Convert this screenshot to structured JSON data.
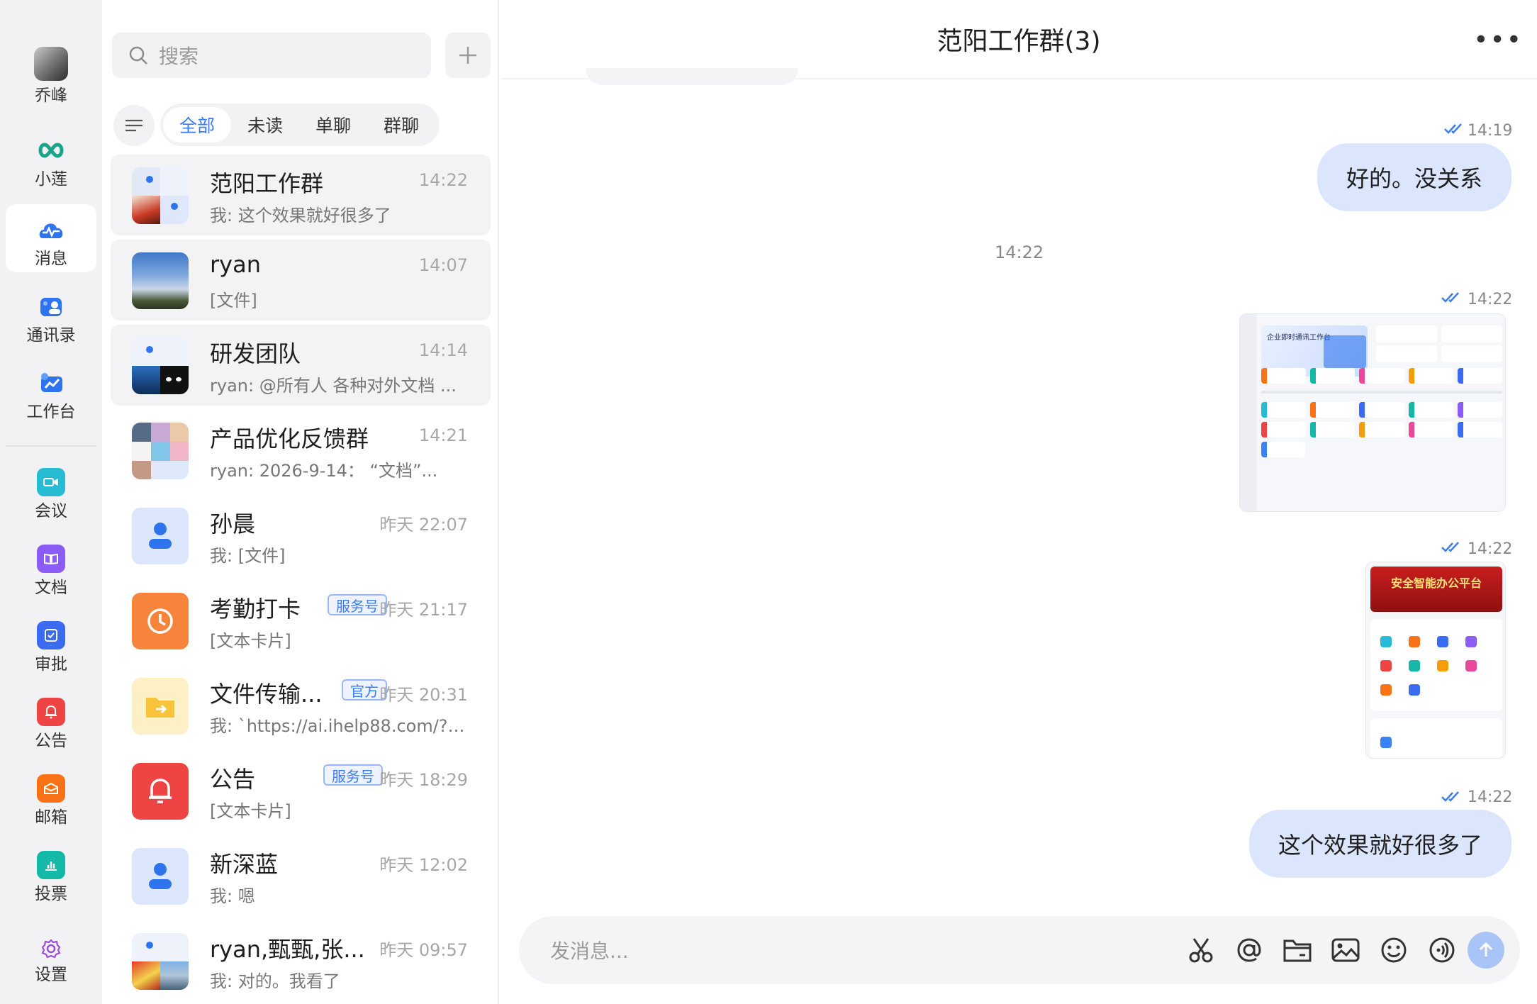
{
  "nav": {
    "profile_label": "乔峰",
    "items": [
      {
        "label": "小莲",
        "icon": "infinity-icon"
      },
      {
        "label": "消息",
        "icon": "chat-cloud-icon"
      },
      {
        "label": "通讯录",
        "icon": "contacts-icon"
      },
      {
        "label": "工作台",
        "icon": "workbench-icon"
      },
      {
        "label": "会议",
        "icon": "video-icon"
      },
      {
        "label": "文档",
        "icon": "book-icon"
      },
      {
        "label": "审批",
        "icon": "approve-icon"
      },
      {
        "label": "公告",
        "icon": "bell-icon"
      },
      {
        "label": "邮箱",
        "icon": "mail-icon"
      },
      {
        "label": "投票",
        "icon": "vote-icon"
      },
      {
        "label": "设置",
        "icon": "gear-icon"
      }
    ]
  },
  "list": {
    "search_placeholder": "搜索",
    "tabs": [
      "全部",
      "未读",
      "单聊",
      "群聊"
    ],
    "conversations": [
      {
        "name": "范阳工作群",
        "time": "14:22",
        "preview": "我: 这个效果就好很多了"
      },
      {
        "name": "ryan",
        "time": "14:07",
        "preview": "[文件]"
      },
      {
        "name": "研发团队",
        "time": "14:14",
        "preview": "ryan: @所有人 各种对外文档 ..."
      },
      {
        "name": "产品优化反馈群",
        "time": "14:21",
        "preview": "ryan: 2026-9-14： “文档”..."
      },
      {
        "name": "孙晨",
        "time": "昨天 22:07",
        "preview": "我: [文件]"
      },
      {
        "name": "考勤打卡",
        "badge": "服务号",
        "time": "昨天 21:17",
        "preview": "[文本卡片]"
      },
      {
        "name": "文件传输...",
        "badge": "官方",
        "time": "昨天 20:31",
        "preview": "我: `https://ai.ihelp88.com/?li..."
      },
      {
        "name": "公告",
        "badge": "服务号",
        "time": "昨天 18:29",
        "preview": "[文本卡片]"
      },
      {
        "name": "新深蓝",
        "time": "昨天 12:02",
        "preview": "我: 嗯"
      },
      {
        "name": "ryan,甄甄,张...",
        "time": "昨天 09:57",
        "preview": "我: 对的。我看了"
      }
    ]
  },
  "chat": {
    "title": "范阳工作群(3)",
    "messages": [
      {
        "time": "14:19",
        "text": "好的。没关系"
      },
      {
        "center_time": "14:22"
      },
      {
        "time": "14:22",
        "image": "企业即时通讯工作台"
      },
      {
        "time": "14:22",
        "image": "安全智能办公平台"
      },
      {
        "time": "14:22",
        "text": "这个效果就好很多了"
      }
    ],
    "input_placeholder": "发消息..."
  },
  "colors": {
    "accent": "#3b7cf6",
    "bubble": "#dbe6fd"
  }
}
